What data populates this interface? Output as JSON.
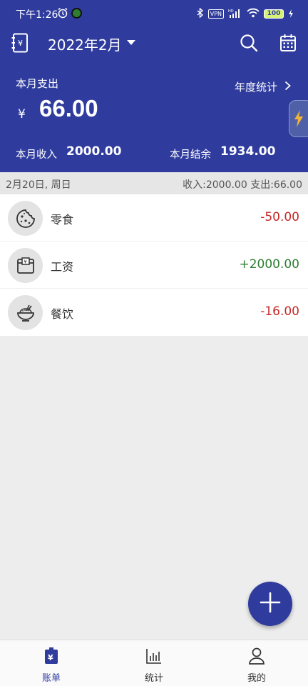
{
  "status": {
    "time": "下午1:26",
    "vpn": "VPN",
    "battery": "100"
  },
  "appbar": {
    "month": "2022年2月"
  },
  "summary": {
    "expense_label": "本月支出",
    "currency": "¥",
    "expense_amount": "66.00",
    "yearly_link": "年度统计",
    "income_label": "本月收入",
    "income_value": "2000.00",
    "balance_label": "本月结余",
    "balance_value": "1934.00"
  },
  "day": {
    "date": "2月20日, 周日",
    "summary": "收入:2000.00  支出:66.00"
  },
  "records": [
    {
      "name": "零食",
      "amount": "-50.00",
      "type": "expense",
      "icon": "cookie-icon"
    },
    {
      "name": "工资",
      "amount": "+2000.00",
      "type": "income",
      "icon": "wallet-icon"
    },
    {
      "name": "餐饮",
      "amount": "-16.00",
      "type": "expense",
      "icon": "rice-bowl-icon"
    }
  ],
  "nav": [
    {
      "label": "账单",
      "icon": "bill-icon",
      "active": true
    },
    {
      "label": "统计",
      "icon": "bar-chart-icon",
      "active": false
    },
    {
      "label": "我的",
      "icon": "person-icon",
      "active": false
    }
  ],
  "colors": {
    "primary": "#2f3c9e",
    "expense": "#c62828",
    "income": "#2e7d32"
  }
}
